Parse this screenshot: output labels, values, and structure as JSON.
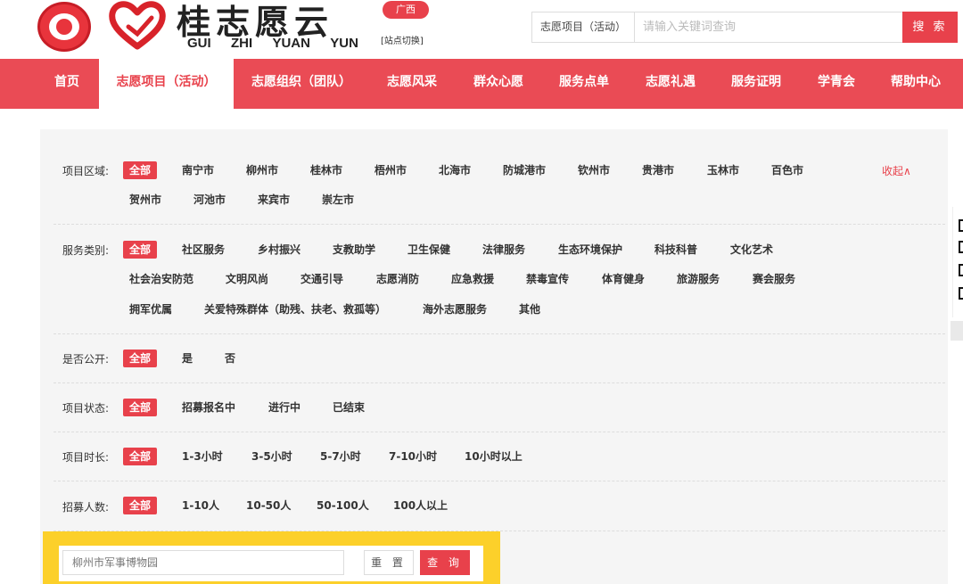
{
  "header": {
    "logo_cn": "桂志愿云",
    "logo_pinyin": [
      "GUI",
      "ZHI",
      "YUAN",
      "YUN"
    ],
    "region_badge": "广西",
    "switch_site": "[站点切换]",
    "search": {
      "category": "志愿项目（活动）",
      "placeholder": "请输入关键词查询",
      "button": "搜 索"
    }
  },
  "nav": {
    "items": [
      "首页",
      "志愿项目（活动）",
      "志愿组织（团队）",
      "志愿风采",
      "群众心愿",
      "服务点单",
      "志愿礼遇",
      "服务证明",
      "学青会",
      "帮助中心"
    ],
    "active_index": 1
  },
  "filters": {
    "collapse_label": "收起∧",
    "rows": [
      {
        "label": "项目区域:",
        "options": [
          "全部",
          "南宁市",
          "柳州市",
          "桂林市",
          "梧州市",
          "北海市",
          "防城港市",
          "钦州市",
          "贵港市",
          "玉林市",
          "百色市",
          "贺州市",
          "河池市",
          "来宾市",
          "崇左市"
        ]
      },
      {
        "label": "服务类别:",
        "options": [
          "全部",
          "社区服务",
          "乡村振兴",
          "支教助学",
          "卫生保健",
          "法律服务",
          "生态环境保护",
          "科技科普",
          "文化艺术",
          "社会治安防范",
          "文明风尚",
          "交通引导",
          "志愿消防",
          "应急救援",
          "禁毒宣传",
          "体育健身",
          "旅游服务",
          "赛会服务",
          "拥军优属",
          "关爱特殊群体（助残、扶老、救孤等）",
          "海外志愿服务",
          "其他"
        ]
      },
      {
        "label": "是否公开:",
        "options": [
          "全部",
          "是",
          "否"
        ]
      },
      {
        "label": "项目状态:",
        "options": [
          "全部",
          "招募报名中",
          "进行中",
          "已结束"
        ]
      },
      {
        "label": "项目时长:",
        "options": [
          "全部",
          "1-3小时",
          "3-5小时",
          "5-7小时",
          "7-10小时",
          "10小时以上"
        ]
      },
      {
        "label": "招募人数:",
        "options": [
          "全部",
          "1-10人",
          "10-50人",
          "50-100人",
          "100人以上"
        ]
      }
    ]
  },
  "query": {
    "value": "柳州市军事博物园",
    "reset": "重 置",
    "submit": "查 询"
  },
  "colors": {
    "accent": "#e8414b",
    "nav_bg": "#ea4b55",
    "panel_bg": "#f5f5f5",
    "highlight": "#fcd02a"
  }
}
